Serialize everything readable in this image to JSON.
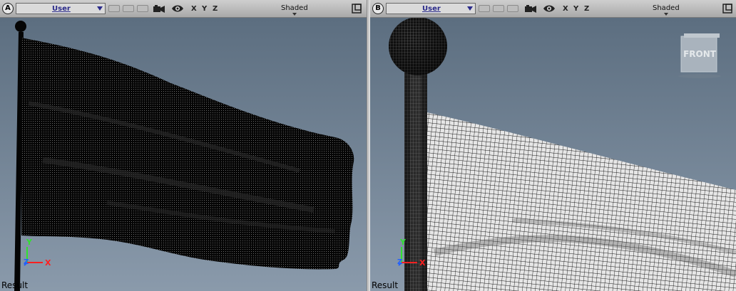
{
  "viewports": [
    {
      "letter": "A",
      "view": "User",
      "axes": [
        "X",
        "Y",
        "Z"
      ],
      "shading": "Shaded",
      "status": "Result",
      "gizmo": {
        "x": "X",
        "y": "Y",
        "z": "Z"
      }
    },
    {
      "letter": "B",
      "view": "User",
      "axes": [
        "X",
        "Y",
        "Z"
      ],
      "shading": "Shaded",
      "status": "Result",
      "gizmo": {
        "x": "X",
        "y": "Y",
        "z": "Z"
      },
      "viewcube": "FRONT"
    }
  ],
  "colors": {
    "viewport_bg_top": "#5c6e80",
    "viewport_bg_bottom": "#8a9aab",
    "mesh_dark": "#050505",
    "mesh_light": "#e4e4e4",
    "axis_x": "#ff2020",
    "axis_y": "#30e030",
    "axis_z": "#2060ff"
  }
}
